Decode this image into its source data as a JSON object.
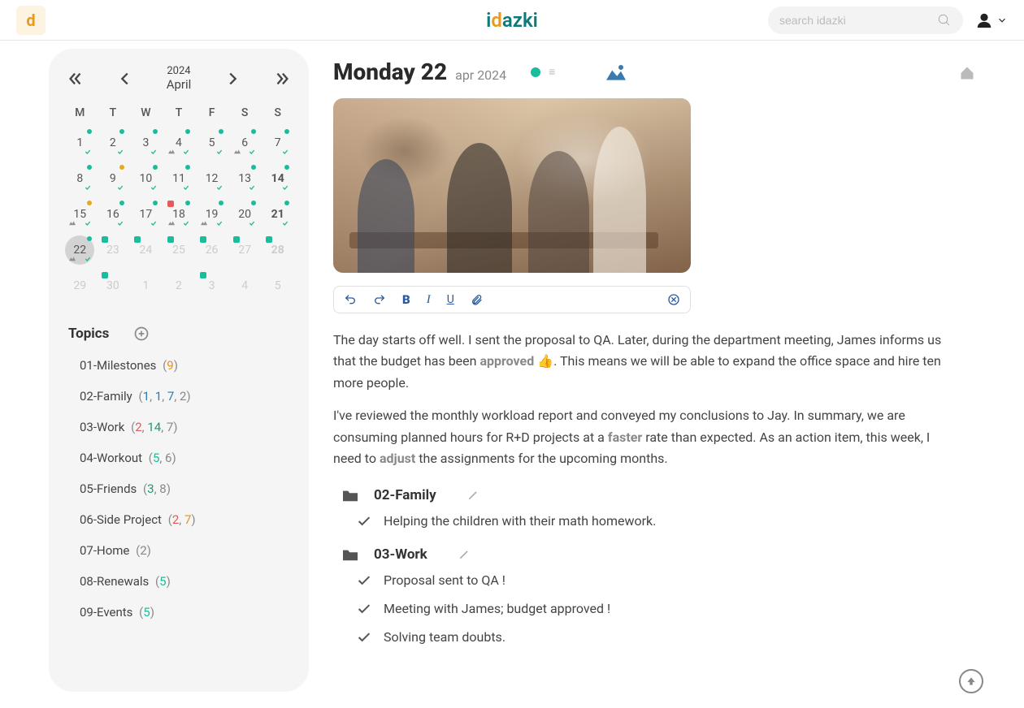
{
  "header": {
    "brand_i": "i",
    "brand_d": "d",
    "brand_rest": "azki",
    "search_placeholder": "search idazki",
    "tab_letter": "d"
  },
  "calendar": {
    "year": "2024",
    "month": "April",
    "dow": [
      "M",
      "T",
      "W",
      "T",
      "F",
      "S",
      "S"
    ],
    "weeks": [
      [
        {
          "n": "1",
          "dot": "green",
          "tick": true
        },
        {
          "n": "2",
          "dot": "green",
          "tick": true
        },
        {
          "n": "3",
          "dot": "green",
          "tick": true
        },
        {
          "n": "4",
          "dot": "green",
          "tick": true,
          "mtn": true
        },
        {
          "n": "5",
          "dot": "green",
          "tick": true
        },
        {
          "n": "6",
          "dot": "green",
          "tick": true,
          "mtn": true
        },
        {
          "n": "7",
          "dot": "green",
          "tick": true
        }
      ],
      [
        {
          "n": "8",
          "dot": "green",
          "tick": true
        },
        {
          "n": "9",
          "dot": "yellow",
          "tick": true
        },
        {
          "n": "10",
          "dot": "green",
          "tick": true
        },
        {
          "n": "11",
          "dot": "green",
          "tick": true
        },
        {
          "n": "12",
          "tick": true
        },
        {
          "n": "13",
          "dot": "green",
          "tick": true
        },
        {
          "n": "14",
          "dot": "green",
          "tick": true,
          "bold": true
        }
      ],
      [
        {
          "n": "15",
          "dot": "yellow",
          "tick": true,
          "mtn": true
        },
        {
          "n": "16",
          "dot": "green",
          "tick": true
        },
        {
          "n": "17",
          "dot": "green",
          "tick": true
        },
        {
          "n": "18",
          "dot": "green",
          "tick": true,
          "sq": "red",
          "mtn": true
        },
        {
          "n": "19",
          "dot": "green",
          "tick": true,
          "mtn": true
        },
        {
          "n": "20",
          "dot": "green",
          "tick": true
        },
        {
          "n": "21",
          "dot": "green",
          "tick": true,
          "bold": true
        }
      ],
      [
        {
          "n": "22",
          "dot": "green",
          "tick": true,
          "mtn": true,
          "selected": true
        },
        {
          "n": "23",
          "dim": true,
          "sq": "green"
        },
        {
          "n": "24",
          "dim": true,
          "sq": "green"
        },
        {
          "n": "25",
          "dim": true,
          "sq": "green"
        },
        {
          "n": "26",
          "dim": true,
          "sq": "green"
        },
        {
          "n": "27",
          "dim": true,
          "sq": "green"
        },
        {
          "n": "28",
          "dim": true,
          "bold": true,
          "sq": "green"
        }
      ],
      [
        {
          "n": "29",
          "dim": true
        },
        {
          "n": "30",
          "dim": true,
          "sq": "green"
        },
        {
          "n": "1",
          "dim": true
        },
        {
          "n": "2",
          "dim": true
        },
        {
          "n": "3",
          "dim": true,
          "sq": "green"
        },
        {
          "n": "4",
          "dim": true
        },
        {
          "n": "5",
          "dim": true
        }
      ]
    ]
  },
  "topics": {
    "title": "Topics",
    "items": [
      {
        "label": "01-Milestones",
        "counts_html": "(<span class='c-orange'>9</span>)"
      },
      {
        "label": "02-Family",
        "counts_html": "(<span class='c-blue'>1</span>, <span class='c-blue'>1</span>, <span class='c-blue'>7</span>, 2)"
      },
      {
        "label": "03-Work",
        "counts_html": "(<span class='c-red'>2</span>, <span class='c-green'>14</span>, 7)"
      },
      {
        "label": "04-Workout",
        "counts_html": "(<span class='c-teal'>5</span>, 6)"
      },
      {
        "label": "05-Friends",
        "counts_html": "(<span class='c-green'>3</span>, 8)"
      },
      {
        "label": "06-Side Project",
        "counts_html": "(<span class='c-red'>2</span>, <span class='c-orange'>7</span>)"
      },
      {
        "label": "07-Home",
        "counts_html": "(2)"
      },
      {
        "label": "08-Renewals",
        "counts_html": "(<span class='c-teal'>5</span>)"
      },
      {
        "label": "09-Events",
        "counts_html": "(<span class='c-teal'>5</span>)"
      }
    ]
  },
  "entry": {
    "title": "Monday 22",
    "sub": "apr 2024",
    "body_p1": "The day starts off well. I sent the proposal to QA. Later, during the department meeting, James in­forms us that the budget has been <b>approved</b> 👍. This means we will be able to expand the office space and hire ten more people.",
    "body_p2": "I've reviewed the monthly workload report and conveyed my conclusions to Jay. In summary, we are consuming planned hours for R+D projects at a <b>faster</b> rate than expected. As an action item, this week, I need to <b>adjust</b> the assignments for the upcoming months.",
    "sections": [
      {
        "title": "02-Family",
        "tasks": [
          "Helping the children with their math homework."
        ]
      },
      {
        "title": "03-Work",
        "tasks": [
          "Proposal sent to QA !",
          "Meeting with James; budget approved !",
          "Solving team doubts."
        ]
      }
    ]
  }
}
